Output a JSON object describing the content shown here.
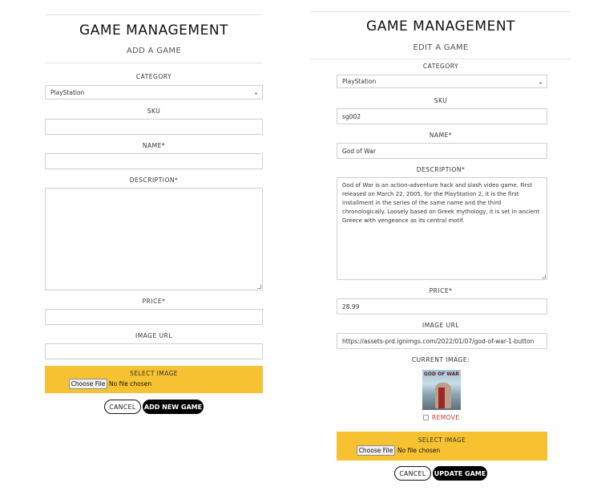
{
  "add_form": {
    "title": "GAME MANAGEMENT",
    "subtitle": "ADD A GAME",
    "category_label": "CATEGORY",
    "category_value": "PlayStation",
    "sku_label": "SKU",
    "sku_value": "",
    "name_label": "NAME*",
    "name_value": "",
    "description_label": "DESCRIPTION*",
    "description_value": "",
    "price_label": "PRICE*",
    "price_value": "",
    "image_url_label": "IMAGE URL",
    "image_url_value": "",
    "select_image_label": "SELECT IMAGE",
    "choose_file_label": "Choose File",
    "no_file_text": "No file chosen",
    "cancel_label": "CANCEL",
    "submit_label": "ADD NEW GAME"
  },
  "edit_form": {
    "title": "GAME MANAGEMENT",
    "subtitle": "EDIT A GAME",
    "category_label": "CATEGORY",
    "category_value": "PlayStation",
    "sku_label": "SKU",
    "sku_value": "sg002",
    "name_label": "NAME*",
    "name_value": "God of War",
    "description_label": "DESCRIPTION*",
    "description_value": "God of War is an action-adventure hack and slash video game. First released on March 22, 2005, for the PlayStation 2, it is the first installment in the series of the same name and the third chronologically. Loosely based on Greek mythology, it is set in ancient Greece with vengeance as its central motif.",
    "price_label": "PRICE*",
    "price_value": "28.99",
    "image_url_label": "IMAGE URL",
    "image_url_value": "https://assets-prd.ignimgs.com/2022/01/07/god-of-war-1-button",
    "current_image_label": "CURRENT IMAGE:",
    "thumbnail_text": "GOD OF WAR",
    "remove_label": "REMOVE",
    "select_image_label": "SELECT IMAGE",
    "choose_file_label": "Choose File",
    "no_file_text": "No file chosen",
    "cancel_label": "CANCEL",
    "submit_label": "UPDATE GAME"
  },
  "colors": {
    "accent_yellow": "#f6c232",
    "button_black": "#000000",
    "remove_red": "#c0392b"
  },
  "icons": {
    "select_caret": "chevron-down-icon",
    "checkbox": "checkbox-icon"
  }
}
